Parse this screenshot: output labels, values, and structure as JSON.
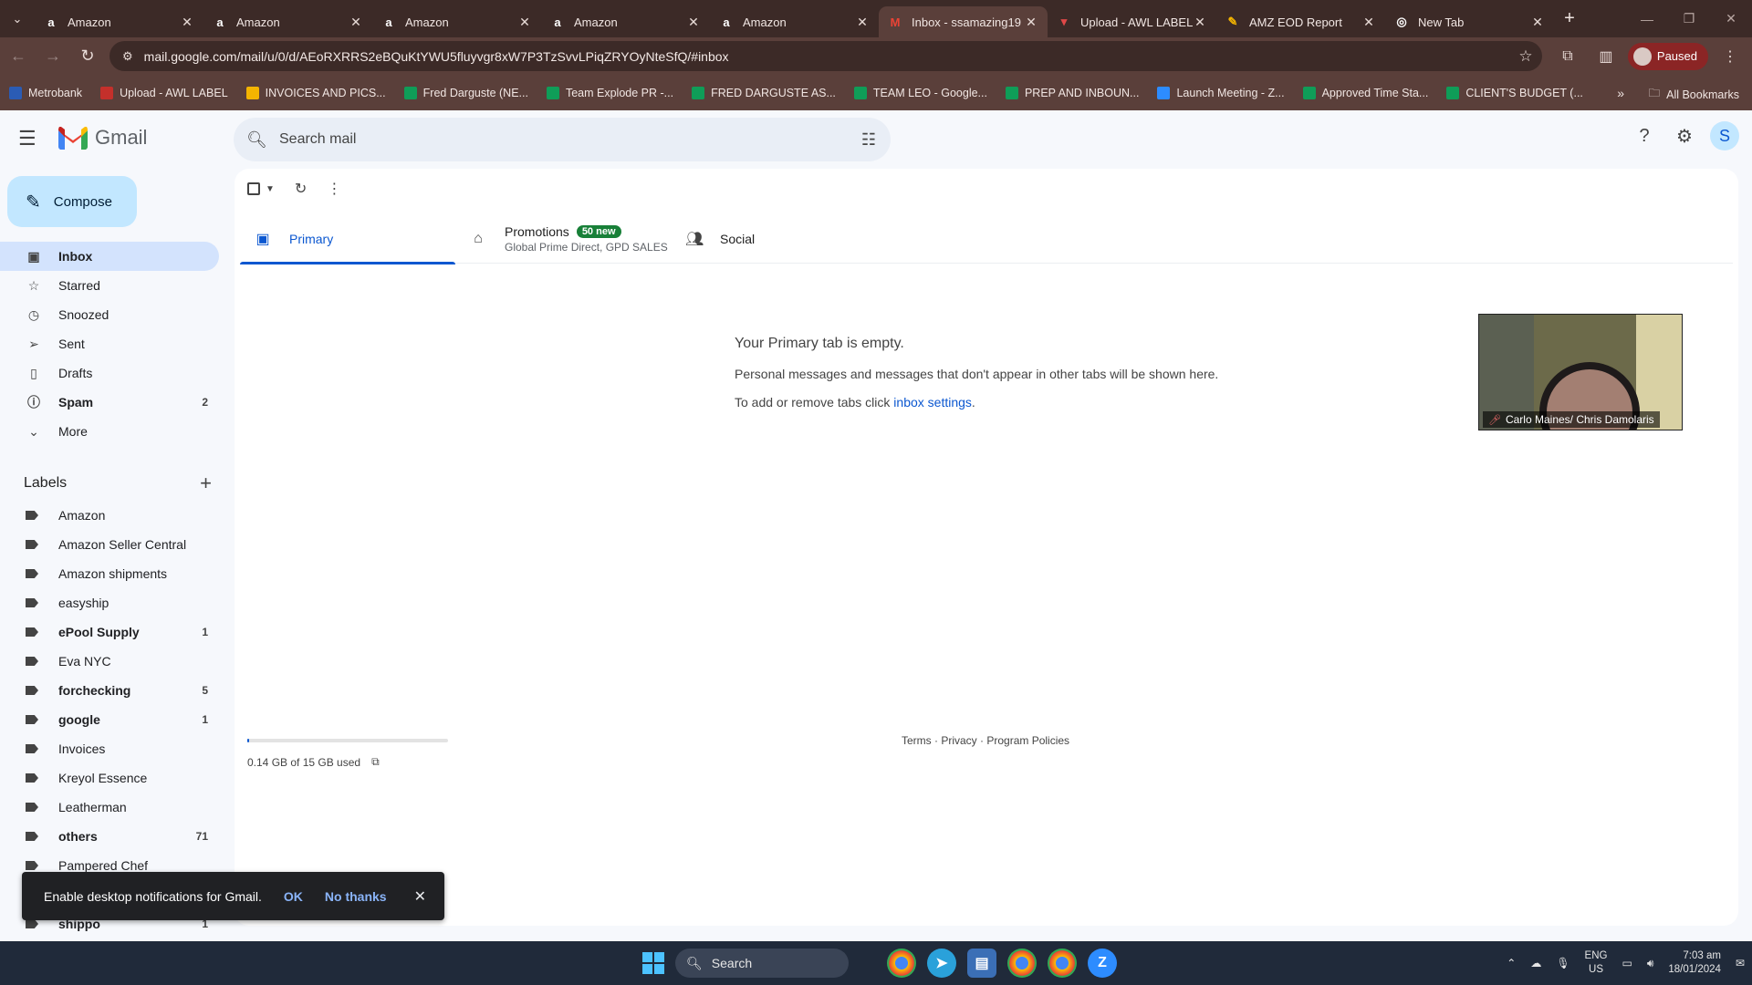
{
  "browser": {
    "tabs": [
      {
        "title": "Amazon",
        "icon": "amazon-icon"
      },
      {
        "title": "Amazon",
        "icon": "amazon-icon"
      },
      {
        "title": "Amazon",
        "icon": "amazon-icon"
      },
      {
        "title": "Amazon",
        "icon": "amazon-icon"
      },
      {
        "title": "Amazon",
        "icon": "amazon-icon"
      },
      {
        "title": "Inbox - ssamazing19",
        "icon": "gmail-icon"
      },
      {
        "title": "Upload - AWL LABEL",
        "icon": "awl-icon"
      },
      {
        "title": "AMZ EOD Report",
        "icon": "report-icon"
      },
      {
        "title": "New Tab",
        "icon": "chrome-icon"
      }
    ],
    "url": "mail.google.com/mail/u/0/d/AEoRXRRS2eBQuKtYWU5fluyvgr8xW7P3TzSvvLPiqZRYOyNteSfQ/#inbox",
    "profile_status": "Paused",
    "bookmarks": [
      {
        "label": "Metrobank",
        "color": "#2b5cb5"
      },
      {
        "label": "Upload - AWL LABEL",
        "color": "#c4302b"
      },
      {
        "label": "INVOICES AND PICS...",
        "color": "#f4b400"
      },
      {
        "label": "Fred Darguste (NE...",
        "color": "#0f9d58"
      },
      {
        "label": "Team Explode PR -...",
        "color": "#0f9d58"
      },
      {
        "label": "FRED DARGUSTE AS...",
        "color": "#0f9d58"
      },
      {
        "label": "TEAM LEO - Google...",
        "color": "#0f9d58"
      },
      {
        "label": "PREP AND INBOUN...",
        "color": "#0f9d58"
      },
      {
        "label": "Launch Meeting - Z...",
        "color": "#2d8cff"
      },
      {
        "label": "Approved Time Sta...",
        "color": "#0f9d58"
      },
      {
        "label": "CLIENT'S BUDGET (...",
        "color": "#0f9d58"
      }
    ],
    "all_bookmarks": "All Bookmarks"
  },
  "gmail": {
    "brand": "Gmail",
    "search_placeholder": "Search mail",
    "account_initial": "S",
    "compose": "Compose",
    "nav": [
      {
        "label": "Inbox",
        "icon": "inbox-icon",
        "count": ""
      },
      {
        "label": "Starred",
        "icon": "star-icon",
        "count": ""
      },
      {
        "label": "Snoozed",
        "icon": "clock-icon",
        "count": ""
      },
      {
        "label": "Sent",
        "icon": "send-icon",
        "count": ""
      },
      {
        "label": "Drafts",
        "icon": "draft-icon",
        "count": ""
      },
      {
        "label": "Spam",
        "icon": "spam-icon",
        "count": "2"
      },
      {
        "label": "More",
        "icon": "chevron-down-icon",
        "count": ""
      }
    ],
    "labels_title": "Labels",
    "labels": [
      {
        "label": "Amazon",
        "count": ""
      },
      {
        "label": "Amazon Seller Central",
        "count": ""
      },
      {
        "label": "Amazon shipments",
        "count": ""
      },
      {
        "label": "easyship",
        "count": ""
      },
      {
        "label": "ePool Supply",
        "count": "1"
      },
      {
        "label": "Eva NYC",
        "count": ""
      },
      {
        "label": "forchecking",
        "count": "5"
      },
      {
        "label": "google",
        "count": "1"
      },
      {
        "label": "Invoices",
        "count": ""
      },
      {
        "label": "Kreyol Essence",
        "count": ""
      },
      {
        "label": "Leatherman",
        "count": ""
      },
      {
        "label": "others",
        "count": "71"
      },
      {
        "label": "Pampered Chef",
        "count": ""
      },
      {
        "label": "",
        "count": ""
      },
      {
        "label": "shippo",
        "count": "1"
      }
    ],
    "category_tabs": {
      "primary": "Primary",
      "promotions": "Promotions",
      "promotions_badge": "50 new",
      "promotions_sub": "Global Prime Direct, GPD SALES",
      "social": "Social"
    },
    "empty": {
      "title": "Your Primary tab is empty.",
      "line1": "Personal messages and messages that don't appear in other tabs will be shown here.",
      "line2_prefix": "To add or remove tabs click ",
      "line2_link": "inbox settings",
      "line2_suffix": "."
    },
    "storage": {
      "text": "0.14 GB of 15 GB used",
      "fraction": 0.0093
    },
    "footer": {
      "terms": "Terms",
      "privacy": "Privacy",
      "policies": "Program Policies"
    },
    "notification": {
      "message": "Enable desktop notifications for Gmail.",
      "ok": "OK",
      "no": "No thanks"
    }
  },
  "video": {
    "caption": "Carlo Maines/ Chris Damolaris"
  },
  "taskbar": {
    "search": "Search",
    "lang_top": "ENG",
    "lang_bottom": "US",
    "time": "7:03 am",
    "date": "18/01/2024"
  }
}
